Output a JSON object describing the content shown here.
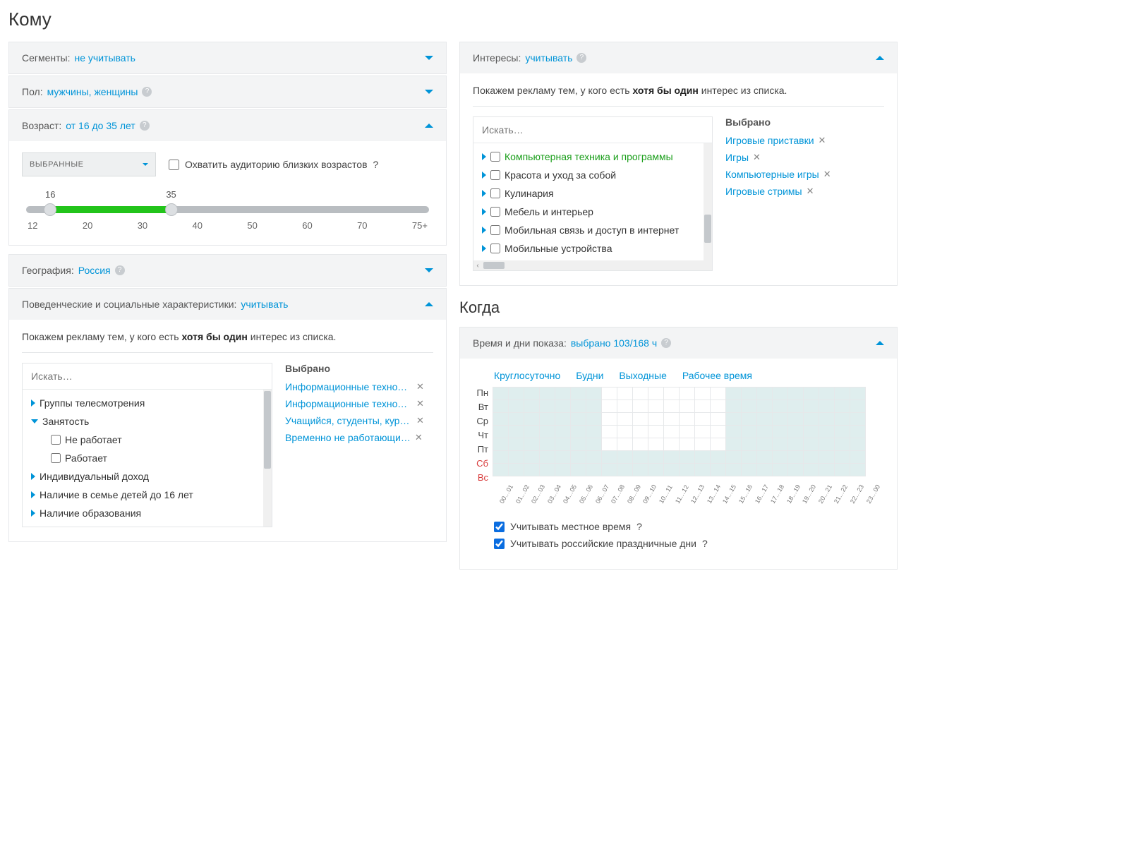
{
  "heading_komu": "Кому",
  "heading_kogda": "Когда",
  "panels": {
    "segments": {
      "label": "Сегменты:",
      "value": "не учитывать"
    },
    "gender": {
      "label": "Пол:",
      "value": "мужчины, женщины"
    },
    "age": {
      "label": "Возраст:",
      "value": "от 16 до 35 лет"
    },
    "geo": {
      "label": "География:",
      "value": "Россия"
    },
    "behav": {
      "label": "Поведенческие и социальные характеристики:",
      "value": "учитывать"
    },
    "interests": {
      "label": "Интересы:",
      "value": "учитывать"
    },
    "schedule": {
      "label": "Время и дни показа:",
      "value": "выбрано 103/168 ч"
    }
  },
  "age": {
    "select_label": "ВЫБРАННЫЕ",
    "nearby_label": "Охватить аудиторию близких возрастов",
    "low": 16,
    "high": 35,
    "ticks": [
      "12",
      "20",
      "30",
      "40",
      "50",
      "60",
      "70",
      "75+"
    ],
    "low_pct": 6,
    "high_pct": 36
  },
  "intro_prefix": "Покажем рекламу тем, у кого есть ",
  "intro_bold": "хотя бы один",
  "intro_suffix": " интерес из списка.",
  "search_placeholder": "Искать…",
  "selected_label": "Выбрано",
  "behaviour": {
    "tree": [
      {
        "label": "Группы телесмотрения",
        "expandable": true
      },
      {
        "label": "Занятость",
        "expandable": true,
        "open": true,
        "children": [
          {
            "label": "Не работает"
          },
          {
            "label": "Работает"
          }
        ]
      },
      {
        "label": "Индивидуальный доход",
        "expandable": true
      },
      {
        "label": "Наличие в семье детей до 16 лет",
        "expandable": true
      },
      {
        "label": "Наличие образования",
        "expandable": true
      }
    ],
    "selected": [
      "Информационные технол…",
      "Информационные технол…",
      "Учащийся, студенты, курс…",
      "Временно не работающи…"
    ]
  },
  "interests": {
    "tree": [
      {
        "label": "Компьютерная техника и программы",
        "green": true
      },
      {
        "label": "Красота и уход за собой"
      },
      {
        "label": "Кулинария"
      },
      {
        "label": "Мебель и интерьер"
      },
      {
        "label": "Мобильная связь и доступ в интернет"
      },
      {
        "label": "Мобильные устройства"
      }
    ],
    "selected": [
      "Игровые приставки",
      "Игры",
      "Компьютерные игры",
      "Игровые стримы"
    ]
  },
  "schedule": {
    "presets": [
      "Круглосуточно",
      "Будни",
      "Выходные",
      "Рабочее время"
    ],
    "days": [
      "Пн",
      "Вт",
      "Ср",
      "Чт",
      "Пт",
      "Сб",
      "Вс"
    ],
    "hour_labels": [
      "00…01",
      "01…02",
      "02…03",
      "03…04",
      "04…05",
      "05…06",
      "06…07",
      "07…08",
      "08…09",
      "09…10",
      "10…11",
      "11…12",
      "12…13",
      "13…14",
      "14…15",
      "15…16",
      "16…17",
      "17…18",
      "18…19",
      "19…20",
      "20…21",
      "21…22",
      "22…23",
      "23…00"
    ],
    "grid": [
      [
        1,
        1,
        1,
        1,
        1,
        1,
        1,
        0,
        0,
        0,
        0,
        0,
        0,
        0,
        0,
        1,
        1,
        1,
        1,
        1,
        1,
        1,
        1,
        1
      ],
      [
        1,
        1,
        1,
        1,
        1,
        1,
        1,
        0,
        0,
        0,
        0,
        0,
        0,
        0,
        0,
        1,
        1,
        1,
        1,
        1,
        1,
        1,
        1,
        1
      ],
      [
        1,
        1,
        1,
        1,
        1,
        1,
        1,
        0,
        0,
        0,
        0,
        0,
        0,
        0,
        0,
        1,
        1,
        1,
        1,
        1,
        1,
        1,
        1,
        1
      ],
      [
        1,
        1,
        1,
        1,
        1,
        1,
        1,
        0,
        0,
        0,
        0,
        0,
        0,
        0,
        0,
        1,
        1,
        1,
        1,
        1,
        1,
        1,
        1,
        1
      ],
      [
        1,
        1,
        1,
        1,
        1,
        1,
        1,
        0,
        0,
        0,
        0,
        0,
        0,
        0,
        0,
        1,
        1,
        1,
        1,
        1,
        1,
        1,
        1,
        1
      ],
      [
        1,
        1,
        1,
        1,
        1,
        1,
        1,
        1,
        1,
        1,
        1,
        1,
        1,
        1,
        1,
        1,
        1,
        1,
        1,
        1,
        1,
        1,
        1,
        1
      ],
      [
        1,
        1,
        1,
        1,
        1,
        1,
        1,
        1,
        1,
        1,
        1,
        1,
        1,
        1,
        1,
        1,
        1,
        1,
        1,
        1,
        1,
        1,
        1,
        1
      ]
    ],
    "opt_local": "Учитывать местное время",
    "opt_holidays": "Учитывать российские праздничные дни"
  }
}
